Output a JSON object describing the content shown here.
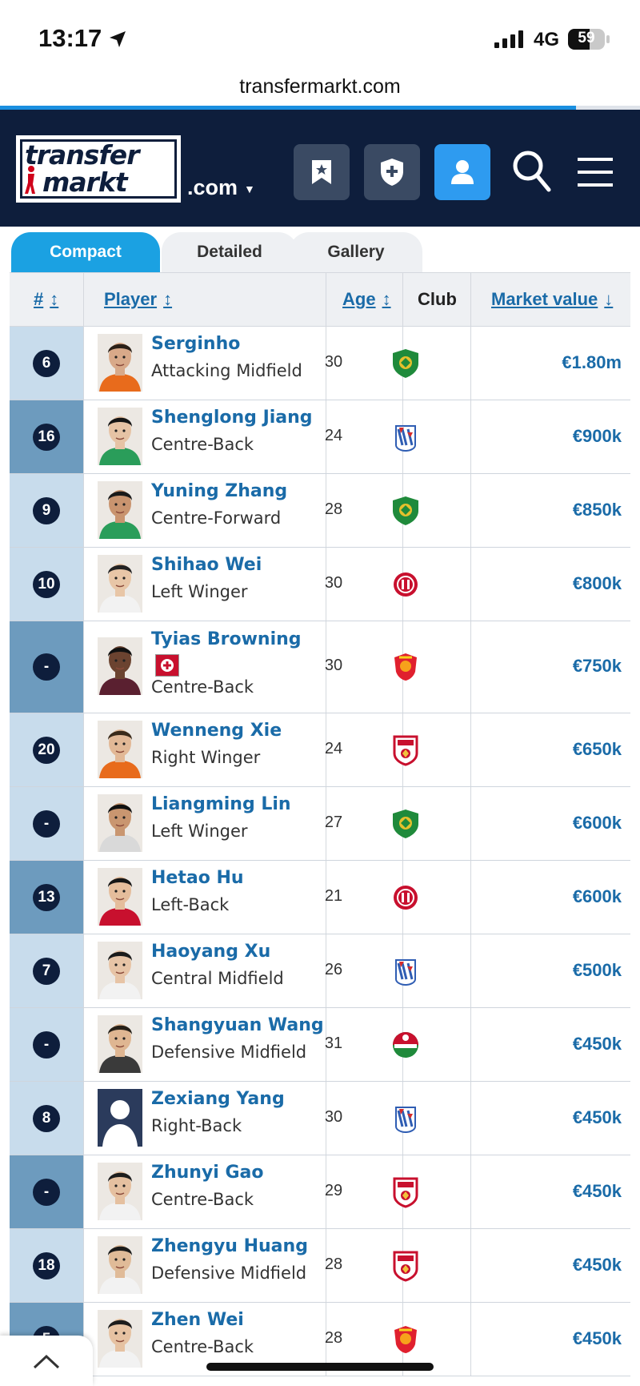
{
  "status": {
    "time": "13:17",
    "network": "4G",
    "battery": "59"
  },
  "browser": {
    "url": "transfermarkt.com",
    "load_progress": 0.9
  },
  "header": {
    "logo_line1": "transfer",
    "logo_line2": "markt",
    "domain": ".com",
    "icons": [
      "bookmark-star-icon",
      "shield-plus-icon",
      "user-icon",
      "search-icon",
      "menu-icon"
    ]
  },
  "tabs": [
    {
      "label": "Compact",
      "active": true
    },
    {
      "label": "Detailed",
      "active": false
    },
    {
      "label": "Gallery",
      "active": false
    }
  ],
  "columns": {
    "number": "#",
    "player": "Player",
    "age": "Age",
    "club": "Club",
    "market_value": "Market value"
  },
  "players": [
    {
      "number": "6",
      "name": "Serginho",
      "position": "Attacking Midfield",
      "age": "30",
      "club_icon": "green-shield-crest",
      "value": "€1.80m"
    },
    {
      "number": "16",
      "name": "Shenglong Jiang",
      "position": "Centre-Back",
      "age": "24",
      "club_icon": "blue-red-crest",
      "value": "€900k"
    },
    {
      "number": "9",
      "name": "Yuning Zhang",
      "position": "Centre-Forward",
      "age": "28",
      "club_icon": "green-shield-crest",
      "value": "€850k"
    },
    {
      "number": "10",
      "name": "Shihao Wei",
      "position": "Left Winger",
      "age": "30",
      "club_icon": "red-round-crest",
      "value": "€800k"
    },
    {
      "number": "-",
      "name": "Tyias Browning",
      "position": "Centre-Back",
      "age": "30",
      "club_icon": "red-orange-crest",
      "value": "€750k",
      "flag": "switzerland-flag"
    },
    {
      "number": "20",
      "name": "Wenneng Xie",
      "position": "Right Winger",
      "age": "24",
      "club_icon": "red-white-shield-crest",
      "value": "€650k"
    },
    {
      "number": "-",
      "name": "Liangming Lin",
      "position": "Left Winger",
      "age": "27",
      "club_icon": "green-shield-crest",
      "value": "€600k"
    },
    {
      "number": "13",
      "name": "Hetao Hu",
      "position": "Left-Back",
      "age": "21",
      "club_icon": "red-round-crest",
      "value": "€600k"
    },
    {
      "number": "7",
      "name": "Haoyang Xu",
      "position": "Central Midfield",
      "age": "26",
      "club_icon": "blue-red-crest",
      "value": "€500k"
    },
    {
      "number": "-",
      "name": "Shangyuan Wang",
      "position": "Defensive Midfield",
      "age": "31",
      "club_icon": "green-red-round-crest",
      "value": "€450k"
    },
    {
      "number": "8",
      "name": "Zexiang Yang",
      "position": "Right-Back",
      "age": "30",
      "club_icon": "blue-red-crest",
      "value": "€450k"
    },
    {
      "number": "-",
      "name": "Zhunyi Gao",
      "position": "Centre-Back",
      "age": "29",
      "club_icon": "red-white-shield-crest",
      "value": "€450k"
    },
    {
      "number": "18",
      "name": "Zhengyu Huang",
      "position": "Defensive Midfield",
      "age": "28",
      "club_icon": "red-white-shield-crest",
      "value": "€450k"
    },
    {
      "number": "5",
      "name": "Zhen Wei",
      "position": "Centre-Back",
      "age": "28",
      "club_icon": "red-orange-crest",
      "value": "€450k"
    }
  ],
  "colors": {
    "header_bg": "#0e1e3c",
    "accent": "#1ba1e2",
    "link": "#1a6ba8",
    "num_light": "#c8dcec",
    "num_dark": "#6d9bbe"
  }
}
